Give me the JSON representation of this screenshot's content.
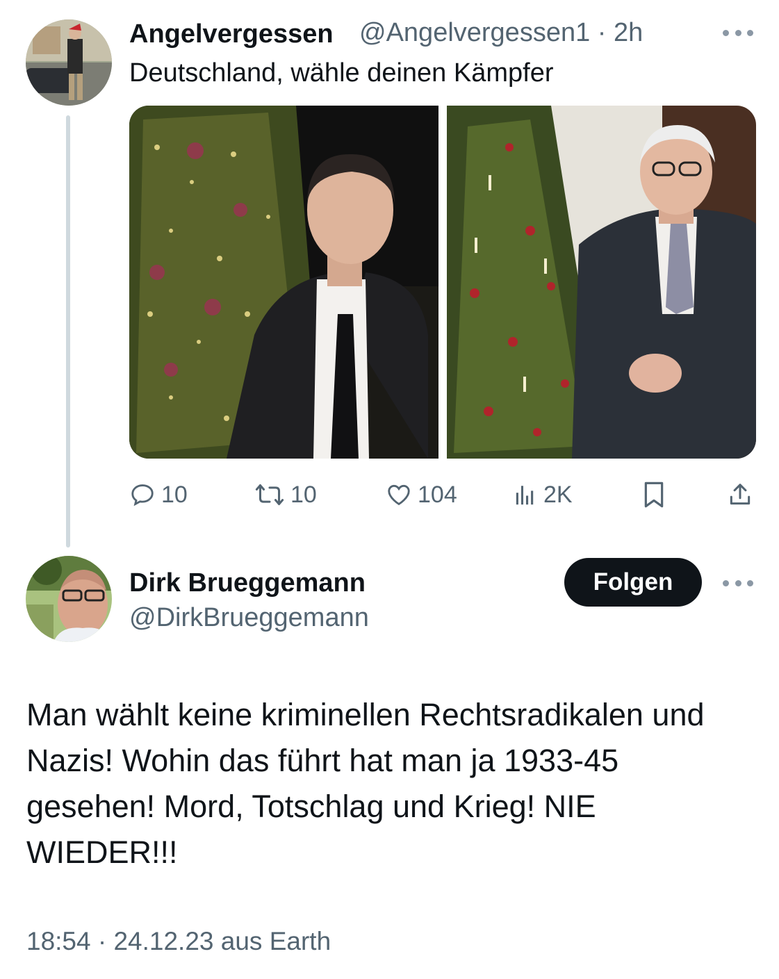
{
  "quoted_tweet": {
    "author_name": "Angelvergessen",
    "author_handle": "@Angelvergessen1",
    "separator": "·",
    "time": "2h",
    "text": "Deutschland, wähle deinen Kämpfer",
    "media": {
      "left_image": "man-in-suit-with-christmas-tree",
      "right_image": "older-man-in-suit-with-christmas-tree"
    },
    "actions": {
      "replies": "10",
      "reposts": "10",
      "likes": "104",
      "views": "2K"
    }
  },
  "reply_tweet": {
    "author_name": "Dirk Brueggemann",
    "author_handle": "@DirkBrueggemann",
    "follow_label": "Folgen",
    "text_lines": [
      "Man wählt keine kriminellen Rechtsradikalen und",
      "Nazis! Wohin das führt hat man ja 1933-45",
      "gesehen! Mord, Totschlag und Krieg! NIE",
      "WIEDER!!!"
    ],
    "timestamp": "18:54 · 24.12.23 aus Earth"
  },
  "icons": [
    "reply-icon",
    "repost-icon",
    "like-icon",
    "views-icon",
    "bookmark-icon",
    "share-icon",
    "more-icon"
  ],
  "colors": {
    "text_primary": "#0f1419",
    "text_secondary": "#536471",
    "thread_line": "#cfd9de",
    "button_bg": "#0f1419",
    "button_text": "#ffffff"
  }
}
